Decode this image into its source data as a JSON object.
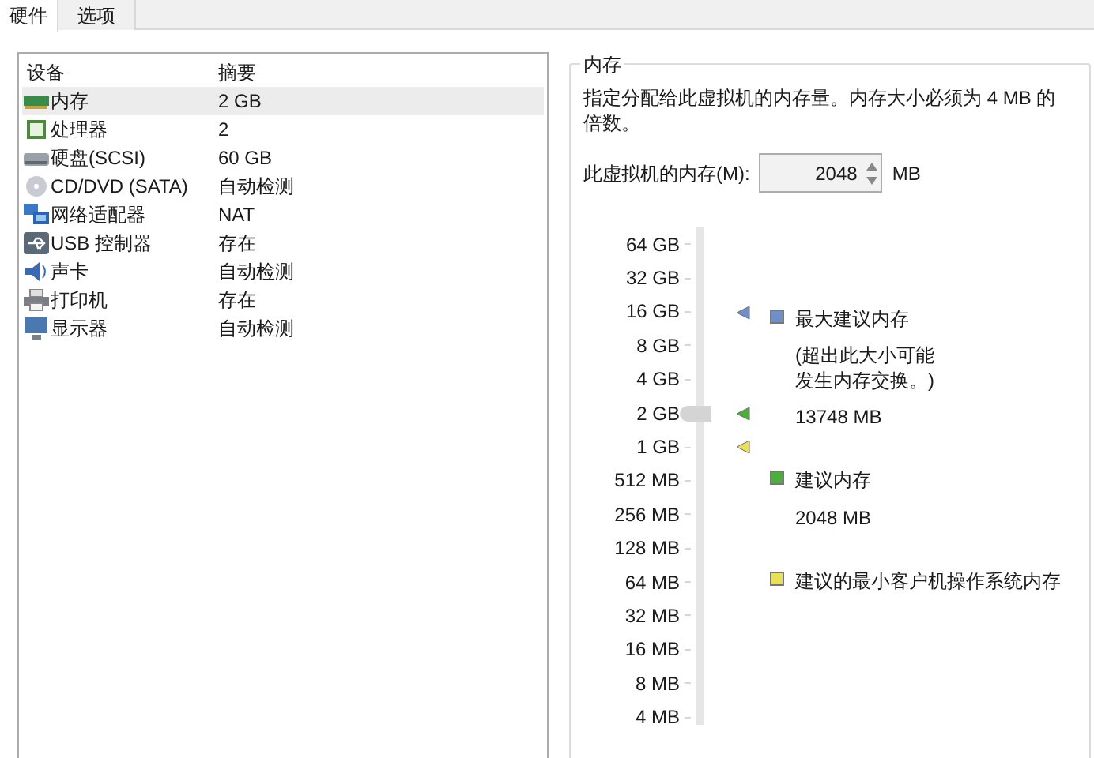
{
  "tabs": [
    {
      "label": "硬件",
      "selected": true
    },
    {
      "label": "选项",
      "selected": false
    }
  ],
  "devices": {
    "columns": [
      "设备",
      "摘要"
    ],
    "rows": [
      {
        "kind": "memory",
        "name": "内存",
        "summary": "2 GB",
        "selected": true
      },
      {
        "kind": "cpu",
        "name": "处理器",
        "summary": "2",
        "selected": false
      },
      {
        "kind": "disk",
        "name": "硬盘(SCSI)",
        "summary": "60 GB",
        "selected": false
      },
      {
        "kind": "cd",
        "name": "CD/DVD (SATA)",
        "summary": "自动检测",
        "selected": false
      },
      {
        "kind": "network",
        "name": "网络适配器",
        "summary": "NAT",
        "selected": false
      },
      {
        "kind": "usb",
        "name": "USB 控制器",
        "summary": "存在",
        "selected": false
      },
      {
        "kind": "sound",
        "name": "声卡",
        "summary": "自动检测",
        "selected": false
      },
      {
        "kind": "printer",
        "name": "打印机",
        "summary": "存在",
        "selected": false
      },
      {
        "kind": "display",
        "name": "显示器",
        "summary": "自动检测",
        "selected": false
      }
    ]
  },
  "memory": {
    "title": "内存",
    "description": "指定分配给此虚拟机的内存量。内存大小必须为 4 MB 的倍数。",
    "field_label": "此虚拟机的内存(M):",
    "value": "2048",
    "unit": "MB",
    "slider": {
      "level": 0.626,
      "markers": [
        {
          "color": "#6f8fc8",
          "level": 0.83
        },
        {
          "color": "#4caf3c",
          "level": 0.626
        },
        {
          "color": "#e8e05a",
          "level": 0.558
        }
      ],
      "ticks": [
        "64 GB",
        "32 GB",
        "16 GB",
        "8 GB",
        "4 GB",
        "2 GB",
        "1 GB",
        "512 MB",
        "256 MB",
        "128 MB",
        "64 MB",
        "32 MB",
        "16 MB",
        "8 MB",
        "4 MB"
      ]
    },
    "legend": [
      {
        "color": "#6f8fc8",
        "label": "最大建议内存",
        "note": "(超出此大小可能发生内存交换。)",
        "value": "13748 MB"
      },
      {
        "color": "#4caf3c",
        "label": "建议内存",
        "value": "2048 MB"
      },
      {
        "color": "#e8e05a",
        "label": "建议的最小客户机操作系统内存"
      }
    ]
  }
}
